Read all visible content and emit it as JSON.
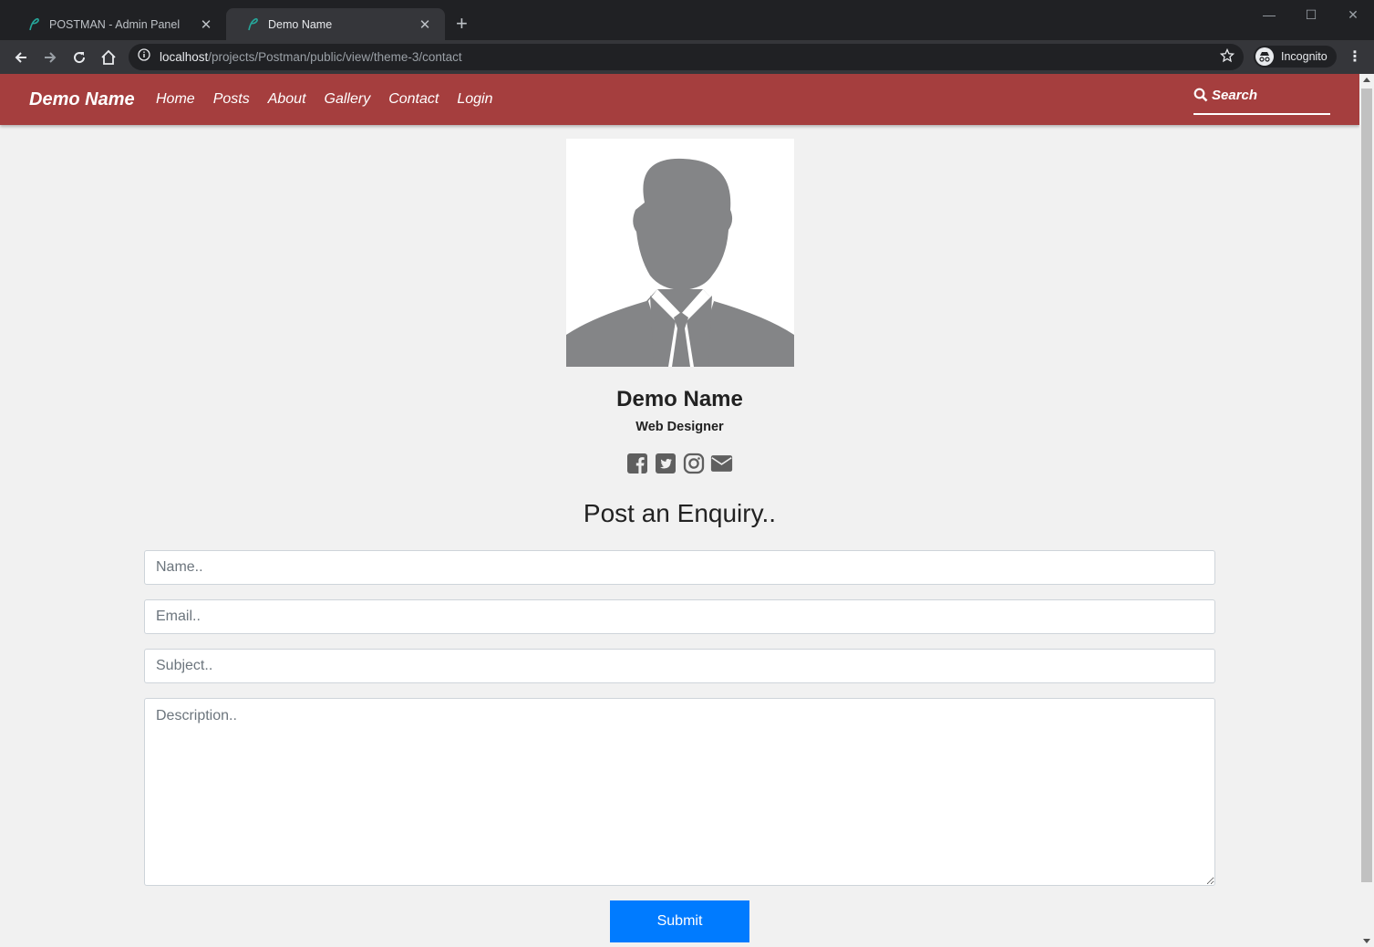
{
  "browser": {
    "tabs": [
      {
        "title": "POSTMAN - Admin Panel",
        "active": false
      },
      {
        "title": "Demo Name",
        "active": true
      }
    ],
    "url_host": "localhost",
    "url_path": "/projects/Postman/public/view/theme-3/contact",
    "profile_label": "Incognito"
  },
  "navbar": {
    "brand": "Demo Name",
    "links": [
      "Home",
      "Posts",
      "About",
      "Gallery",
      "Contact",
      "Login"
    ],
    "search_label": "Search",
    "color": "#a53e3e"
  },
  "profile": {
    "name": "Demo Name",
    "role": "Web Designer",
    "socials": [
      "facebook-icon",
      "twitter-icon",
      "instagram-icon",
      "envelope-icon"
    ]
  },
  "enquiry": {
    "title": "Post an Enquiry..",
    "name_placeholder": "Name..",
    "email_placeholder": "Email..",
    "subject_placeholder": "Subject..",
    "description_placeholder": "Description..",
    "submit_label": "Submit",
    "submit_color": "#007bff"
  }
}
